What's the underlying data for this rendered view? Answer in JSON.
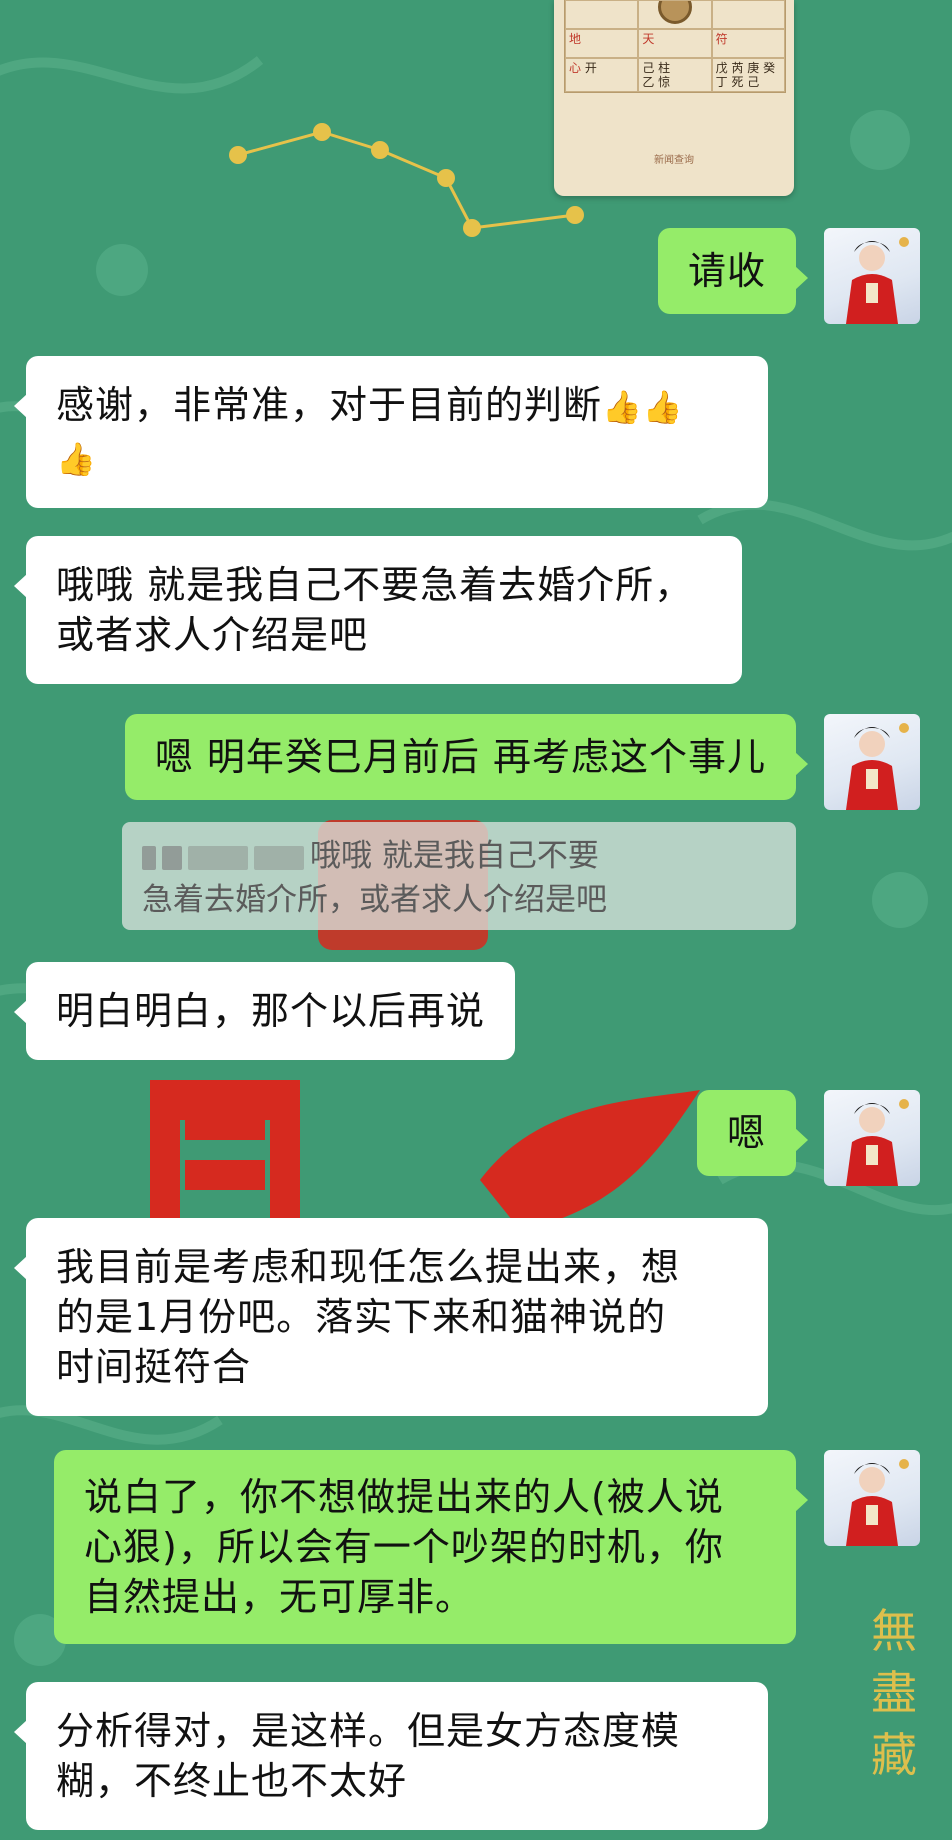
{
  "colors": {
    "background": "#3f9a74",
    "incoming_bubble": "#ffffff",
    "outgoing_bubble": "#95ec69",
    "quote_bubble": "#d7e1dc",
    "decor_red": "#d62a1f",
    "decor_gold": "#e6c24a"
  },
  "chart_card": {
    "label_row1": [
      "地",
      "天",
      "符"
    ],
    "cells": [
      [
        "心",
        "己 柱",
        "戊 芮 庚 癸"
      ],
      [
        "开",
        "乙 惊",
        "丁 死 己"
      ]
    ],
    "footer": "新闻查询"
  },
  "messages": [
    {
      "side": "out",
      "text": "请收"
    },
    {
      "side": "in",
      "text": "感谢，非常准，对于目前的判断",
      "emoji": [
        "👍",
        "👍",
        "👍"
      ]
    },
    {
      "side": "in",
      "text_lines": [
        "哦哦 就是我自己不要急着去婚介所，",
        "或者求人介绍是吧"
      ]
    },
    {
      "side": "out",
      "text": "嗯 明年癸巳月前后 再考虑这个事儿"
    },
    {
      "side": "quote",
      "text_lines": [
        "哦哦 就是我自己不要",
        "急着去婚介所，或者求人介绍是吧"
      ]
    },
    {
      "side": "in",
      "text": "明白明白，那个以后再说"
    },
    {
      "side": "out",
      "text": "嗯"
    },
    {
      "side": "in",
      "text_lines": [
        "我目前是考虑和现任怎么提出来，想",
        "的是1月份吧。落实下来和猫神说的",
        "时间挺符合"
      ]
    },
    {
      "side": "out",
      "text_lines": [
        "说白了，你不想做提出来的人(被人说",
        "心狠)，所以会有一个吵架的时机，你",
        "自然提出，无可厚非。"
      ]
    },
    {
      "side": "in",
      "text_lines": [
        "分析得对，是这样。但是女方态度模",
        "糊，不终止也不太好"
      ]
    }
  ],
  "watermark": [
    "無",
    "盡",
    "藏"
  ]
}
